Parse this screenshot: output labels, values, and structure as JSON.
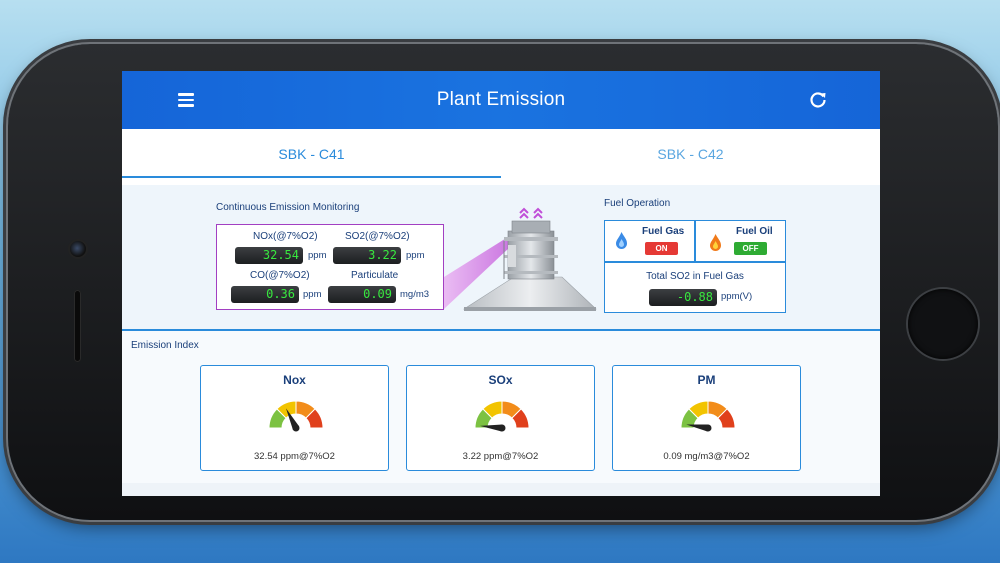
{
  "app": {
    "title": "Plant Emission"
  },
  "tabs": [
    {
      "label": "SBK - C41",
      "active": true
    },
    {
      "label": "SBK - C42",
      "active": false
    }
  ],
  "cem": {
    "label": "Continuous Emission Monitoring",
    "items": [
      {
        "label": "NOx(@7%O2)",
        "value": "32.54",
        "unit": "ppm"
      },
      {
        "label": "SO2(@7%O2)",
        "value": "3.22",
        "unit": "ppm"
      },
      {
        "label": "CO(@7%O2)",
        "value": "0.36",
        "unit": "ppm"
      },
      {
        "label": "Particulate",
        "value": "0.09",
        "unit": "mg/m3"
      }
    ]
  },
  "fuel": {
    "label": "Fuel Operation",
    "gas": {
      "label": "Fuel Gas",
      "status": "ON"
    },
    "oil": {
      "label": "Fuel Oil",
      "status": "OFF"
    },
    "so2": {
      "label": "Total SO2 in Fuel Gas",
      "value": "-0.88",
      "unit": "ppm(V)"
    }
  },
  "emission_index": {
    "label": "Emission Index",
    "gauges": [
      {
        "title": "Nox",
        "reading": "32.54 ppm@7%O2",
        "level": 0.35
      },
      {
        "title": "SOx",
        "reading": "3.22 ppm@7%O2",
        "level": 0.03
      },
      {
        "title": "PM",
        "reading": "0.09 mg/m3@7%O2",
        "level": 0.05
      }
    ]
  },
  "colors": {
    "appbar": "#1a73e0",
    "accent": "#2a8bdb",
    "value_text": "#38e83f",
    "gauge_green": "#7cc242",
    "gauge_yellow": "#f2c400",
    "gauge_orange": "#f28c1a",
    "gauge_red": "#e0401c"
  },
  "icons": {
    "menu": "menu-icon",
    "refresh": "refresh-icon",
    "gas": "flame-blue-icon",
    "oil": "flame-orange-icon"
  }
}
